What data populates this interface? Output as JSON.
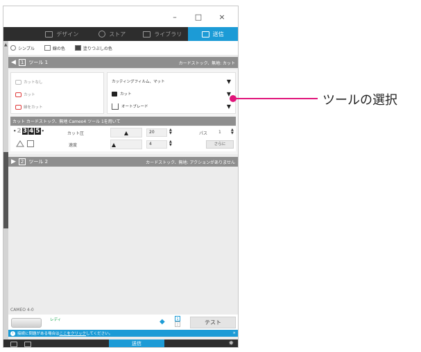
{
  "window": {
    "minimize": "–",
    "maximize": "□",
    "close": "×"
  },
  "nav": {
    "tabs": [
      {
        "label": "デザイン",
        "icon": "grid-icon"
      },
      {
        "label": "ストア",
        "icon": "store-icon"
      },
      {
        "label": "ライブラリ",
        "icon": "library-icon"
      },
      {
        "label": "送信",
        "icon": "send-icon"
      }
    ],
    "active_color": "#1c9bd6"
  },
  "mode": {
    "options": [
      "シンプル",
      "線の色",
      "塗りつぶしの色"
    ],
    "selected": "シンプル"
  },
  "tool1": {
    "arrow": "◀",
    "number": "1",
    "title": "ツール 1",
    "summary": "カードストック、無地: カット",
    "cut_options": [
      "カットなし",
      "カット",
      "縁をカット"
    ],
    "media": "カッティングフィルム、マット",
    "action": "カット",
    "blade": "オートブレード",
    "info": "カット カードストック、無地 Cameo4 ツール 1を用いて",
    "depth_digits": [
      "2",
      "3",
      "4",
      "5"
    ],
    "force_label": "カット圧",
    "force_value": "20",
    "speed_label": "速度",
    "speed_value": "4",
    "passes_label": "パス",
    "passes_value": "1",
    "more_label": "さらに",
    "force_fraction": 0.5,
    "speed_fraction": 0.1
  },
  "tool2": {
    "arrow": "▶",
    "number": "2",
    "title": "ツール 2",
    "summary": "カードストック、無地: アクションがありません"
  },
  "device": {
    "name": "CAMEO 4-0",
    "status": "レディ",
    "slots": [
      "1",
      "2"
    ],
    "test_label": "テスト"
  },
  "help": {
    "info_icon": "i",
    "text_before": "接続に問題がある場合は",
    "link": "ここをクリック",
    "text_after": "してください。",
    "close": "×"
  },
  "footer": {
    "send_label": "送信"
  },
  "callout": {
    "label": "ツールの選択",
    "color": "#e0157a"
  }
}
